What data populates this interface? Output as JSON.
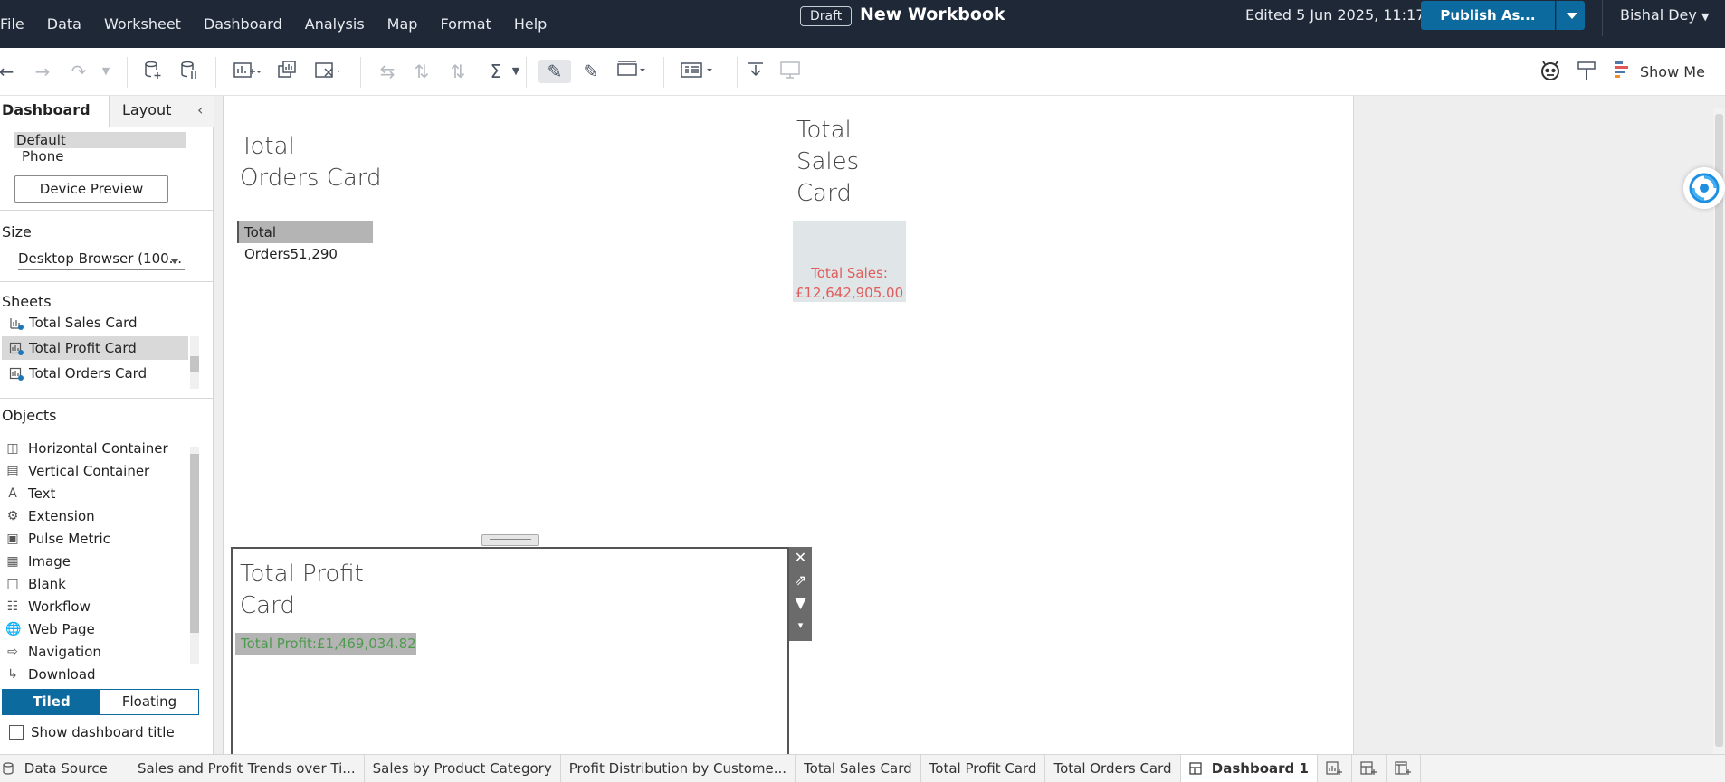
{
  "menu": {
    "items": [
      "File",
      "Data",
      "Worksheet",
      "Dashboard",
      "Analysis",
      "Map",
      "Format",
      "Help"
    ],
    "draft_label": "Draft",
    "workbook_title": "New Workbook",
    "edited": "Edited 5 Jun 2025, 11:17",
    "publish_label": "Publish As...",
    "user_name": "Bishal Dey"
  },
  "toolbar": {
    "show_me_label": "Show Me"
  },
  "left_panel": {
    "tab_dashboard": "Dashboard",
    "tab_layout": "Layout",
    "device_default": "Default",
    "device_phone": "Phone",
    "device_preview_label": "Device Preview",
    "size_title": "Size",
    "size_value": "Desktop Browser (100...",
    "sheets_title": "Sheets",
    "sheets": [
      {
        "label": "Total Sales Card"
      },
      {
        "label": "Total Profit Card"
      },
      {
        "label": "Total Orders Card"
      }
    ],
    "objects_title": "Objects",
    "objects": [
      {
        "label": "Horizontal Container",
        "icon": "horizontal-container-icon"
      },
      {
        "label": "Vertical Container",
        "icon": "vertical-container-icon"
      },
      {
        "label": "Text",
        "icon": "text-icon"
      },
      {
        "label": "Extension",
        "icon": "extension-icon"
      },
      {
        "label": "Pulse Metric",
        "icon": "pulse-metric-icon"
      },
      {
        "label": "Image",
        "icon": "image-icon"
      },
      {
        "label": "Blank",
        "icon": "blank-icon"
      },
      {
        "label": "Workflow",
        "icon": "workflow-icon"
      },
      {
        "label": "Web Page",
        "icon": "web-page-icon"
      },
      {
        "label": "Navigation",
        "icon": "navigation-icon"
      },
      {
        "label": "Download",
        "icon": "download-icon"
      }
    ],
    "tiled_label": "Tiled",
    "floating_label": "Floating",
    "show_title_label": "Show dashboard title"
  },
  "dashboard": {
    "orders_title_line1": "Total",
    "orders_title_line2": "Orders Card",
    "orders_value": "Total Orders51,290",
    "sales_title_line1": "Total",
    "sales_title_line2": "Sales",
    "sales_title_line3": "Card",
    "sales_value_line1": "Total Sales:",
    "sales_value_line2": "£12,642,905.00",
    "profit_title_line1": "Total Profit",
    "profit_title_line2": "Card",
    "profit_value": "Total Profit:£1,469,034.82"
  },
  "bottom_tabs": {
    "data_source": "Data Source",
    "tabs": [
      "Sales and Profit Trends over Ti...",
      "Sales by Product Category",
      "Profit Distribution by Custome...",
      "Total Sales Card",
      "Total Profit Card",
      "Total Orders Card"
    ],
    "active": "Dashboard 1"
  },
  "colors": {
    "menubar_bg": "#1f2837",
    "accent": "#0d6a9e",
    "sales_text": "#e05c5c",
    "profit_text": "#4e9a4e"
  }
}
